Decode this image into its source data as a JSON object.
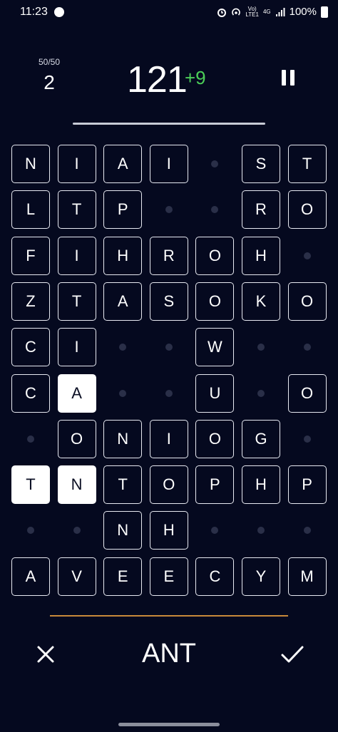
{
  "status_bar": {
    "time": "11:23",
    "network_top": "Vo)",
    "network_bottom": "LTE1",
    "data_label": "4G",
    "battery_text": "100%",
    "icons": [
      "app-notification-icon",
      "alarm-icon",
      "hotspot-icon",
      "signal-icon",
      "battery-icon"
    ]
  },
  "game": {
    "moves": "50/50",
    "counter": "2",
    "score": "121",
    "bonus": "+9",
    "progress": 1.0,
    "current_word": "ANT"
  },
  "grid": {
    "rows": [
      [
        "N",
        "I",
        "A",
        "I",
        "",
        "S",
        "T"
      ],
      [
        "L",
        "T",
        "P",
        "",
        "",
        "R",
        "O"
      ],
      [
        "F",
        "I",
        "H",
        "R",
        "O",
        "H",
        ""
      ],
      [
        "Z",
        "T",
        "A",
        "S",
        "O",
        "K",
        "O"
      ],
      [
        "C",
        "I",
        "",
        "",
        "W",
        "",
        ""
      ],
      [
        "C",
        "A",
        "",
        "",
        "U",
        "",
        "O"
      ],
      [
        "",
        "O",
        "N",
        "I",
        "O",
        "G",
        ""
      ],
      [
        "T",
        "N",
        "T",
        "O",
        "P",
        "H",
        "P"
      ],
      [
        "",
        "",
        "N",
        "H",
        "",
        "",
        ""
      ],
      [
        "A",
        "V",
        "E",
        "E",
        "C",
        "Y",
        "M"
      ]
    ],
    "selected": [
      [
        5,
        1
      ],
      [
        7,
        0
      ],
      [
        7,
        1
      ]
    ]
  },
  "colors": {
    "background": "#05091f",
    "bonus": "#4ccf58",
    "word_underline": "#c8893a",
    "empty_dot": "#2a2f48"
  }
}
